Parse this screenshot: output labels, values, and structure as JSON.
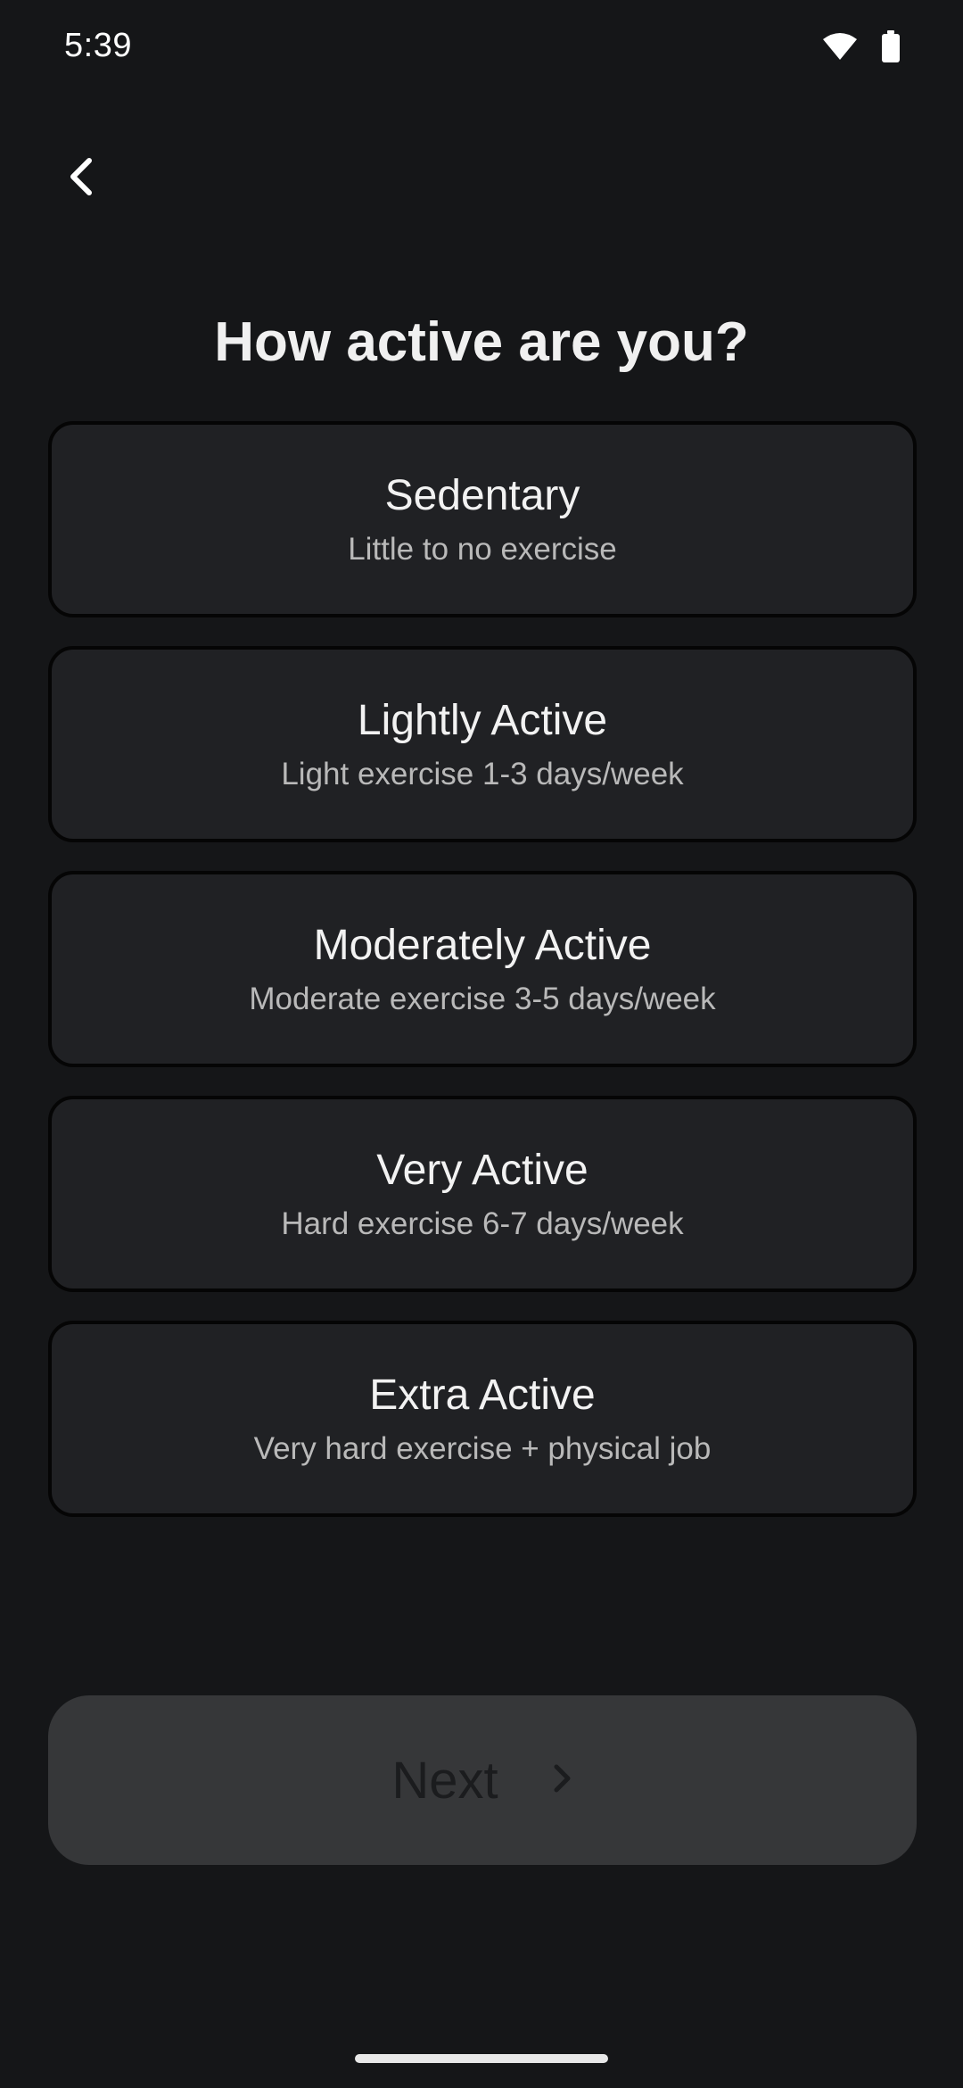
{
  "status_bar": {
    "time": "5:39",
    "icons": [
      "wifi-icon",
      "battery-icon"
    ]
  },
  "header": {
    "back_icon": "chevron-left-icon"
  },
  "page": {
    "title": "How active are you?"
  },
  "options": [
    {
      "title": "Sedentary",
      "subtitle": "Little to no exercise"
    },
    {
      "title": "Lightly Active",
      "subtitle": "Light exercise 1-3 days/week"
    },
    {
      "title": "Moderately Active",
      "subtitle": "Moderate exercise 3-5 days/week"
    },
    {
      "title": "Very Active",
      "subtitle": "Hard exercise 6-7 days/week"
    },
    {
      "title": "Extra Active",
      "subtitle": "Very hard exercise + physical job"
    }
  ],
  "footer": {
    "next_label": "Next",
    "next_icon": "chevron-right-icon",
    "next_enabled": false
  },
  "colors": {
    "background": "#151618",
    "card": "#202124",
    "card_border": "#050505",
    "button_disabled": "#363739"
  }
}
